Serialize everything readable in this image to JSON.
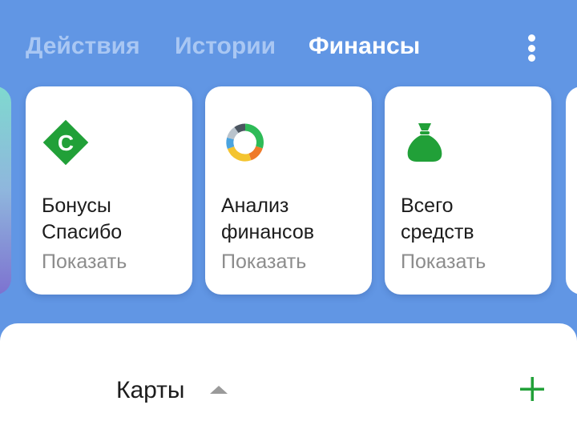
{
  "tabs": [
    {
      "label": "Действия",
      "active": false
    },
    {
      "label": "Истории",
      "active": false
    },
    {
      "label": "Финансы",
      "active": true
    }
  ],
  "menu": {
    "icon": "more-vertical-icon"
  },
  "cards": [
    {
      "icon": "spasibo-bonus-icon",
      "icon_letter": "С",
      "title_line1": "Бонусы",
      "title_line2": "Спасибо",
      "action": "Показать"
    },
    {
      "icon": "finance-analysis-donut-icon",
      "title_line1": "Анализ",
      "title_line2": "финансов",
      "action": "Показать"
    },
    {
      "icon": "money-bag-icon",
      "title_line1": "Всего",
      "title_line2": "средств",
      "action": "Показать"
    }
  ],
  "cards_section": {
    "title": "Карты",
    "collapse_icon": "caret-up-icon",
    "add_icon": "plus-icon"
  },
  "colors": {
    "background": "#6196e4",
    "tab_active": "#ffffff",
    "tab_inactive": "#a9c7f3",
    "accent_green": "#21a038"
  }
}
